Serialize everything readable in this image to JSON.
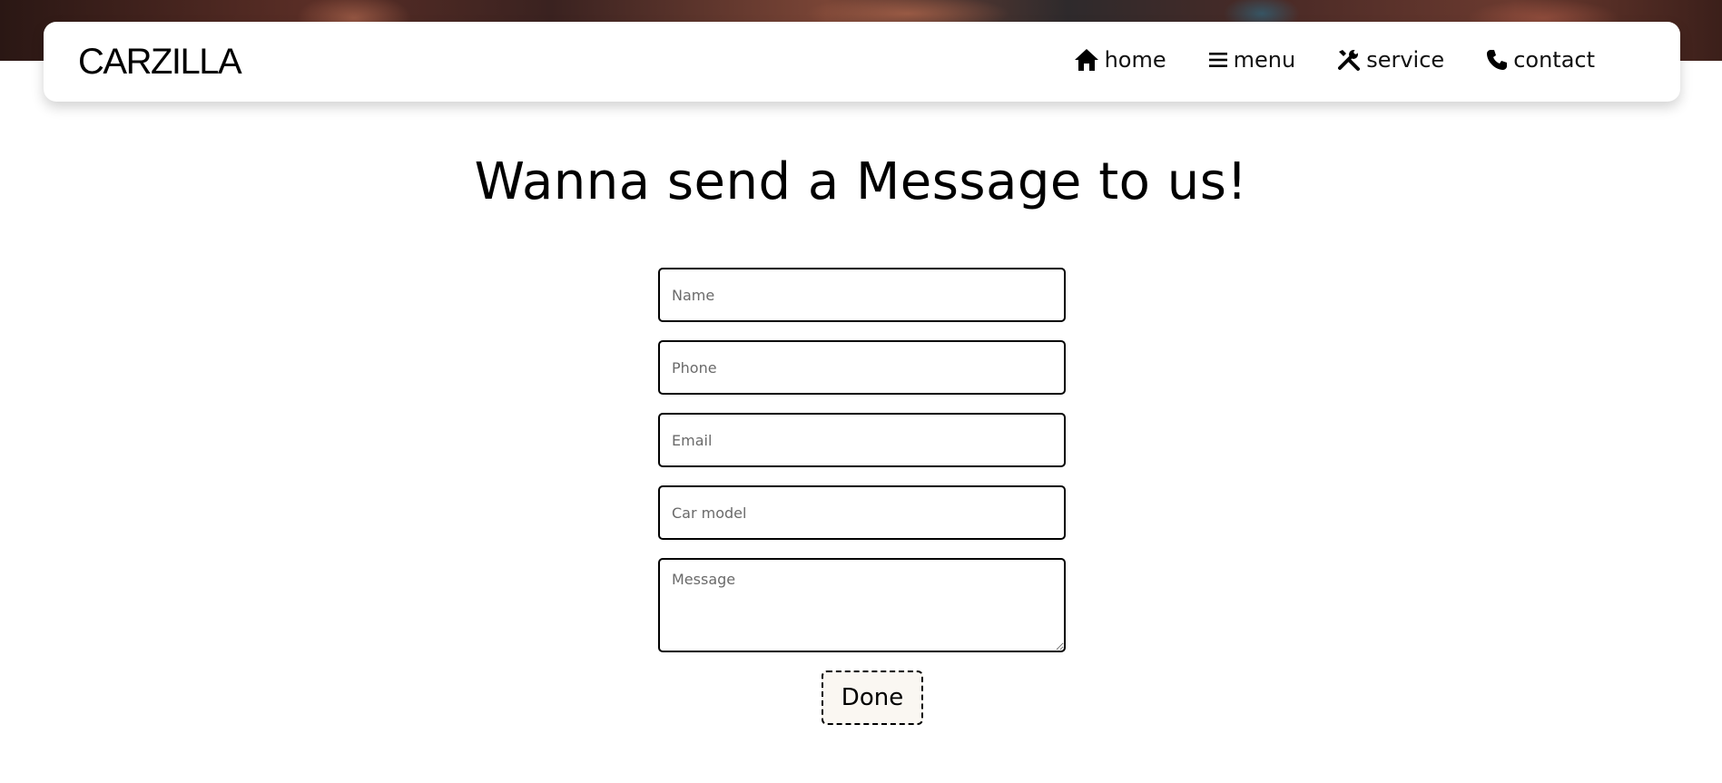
{
  "header": {
    "brand": "CARZILLA",
    "nav": [
      {
        "label": "home",
        "icon": "home-icon"
      },
      {
        "label": "menu",
        "icon": "menu-icon"
      },
      {
        "label": "service",
        "icon": "tools-icon"
      },
      {
        "label": "contact",
        "icon": "phone-icon"
      }
    ]
  },
  "main": {
    "title": "Wanna send a Message to us!",
    "form": {
      "name_placeholder": "Name",
      "phone_placeholder": "Phone",
      "email_placeholder": "Email",
      "car_model_placeholder": "Car model",
      "message_placeholder": "Message",
      "submit_label": "Done"
    }
  },
  "colors": {
    "text": "#000000",
    "background": "#ffffff",
    "button_background": "#faf7f2"
  }
}
